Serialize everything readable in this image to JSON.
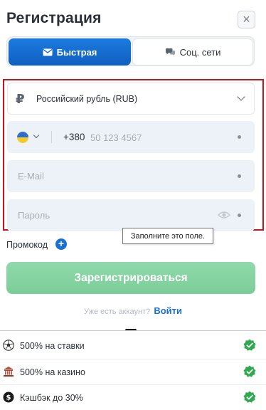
{
  "header": {
    "title": "Регистрация",
    "close_label": "×"
  },
  "tabs": [
    {
      "label": "Быстрая",
      "active": true,
      "icon": "envelope-icon"
    },
    {
      "label": "Соц. сети",
      "active": false,
      "icon": "chat-icon"
    }
  ],
  "form": {
    "currency": {
      "icon": "ruble-icon",
      "value": "Российский рубль (RUB)"
    },
    "phone": {
      "country": "Ukraine",
      "code": "+380",
      "placeholder": "50 123 4567"
    },
    "email": {
      "placeholder": "E-Mail"
    },
    "password": {
      "placeholder": "Пароль"
    },
    "tooltip": "Заполните это поле."
  },
  "promo": {
    "label": "Промокод"
  },
  "register": {
    "label": "Зарегистрироваться"
  },
  "account": {
    "question": "Уже есть аккаунт?",
    "login_link": "Войти"
  },
  "bonuses": [
    {
      "icon": "soccer-ball-icon",
      "text": "500% на ставки"
    },
    {
      "icon": "casino-icon",
      "text": "500% на казино"
    },
    {
      "icon": "cashback-icon",
      "text": "Кэшбэк до 30%"
    }
  ],
  "colors": {
    "accent_blue": "#1a6fd6",
    "register_green": "#7ccd99",
    "highlight_red": "#c3161c",
    "check_green": "#2fa84f"
  }
}
